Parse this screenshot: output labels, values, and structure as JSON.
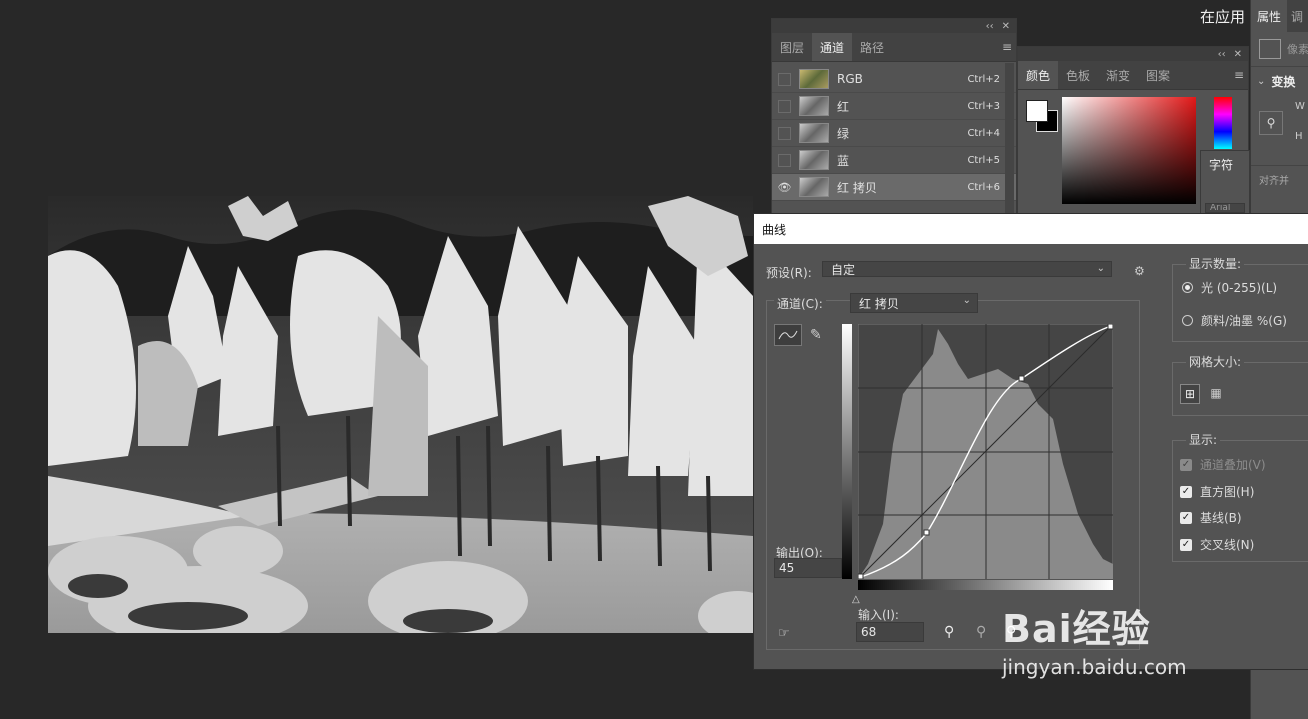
{
  "top_right_text": "在应用",
  "channels_panel": {
    "tabs": [
      "图层",
      "通道",
      "路径"
    ],
    "active_tab": "通道",
    "channels": [
      {
        "name": "RGB",
        "shortcut": "Ctrl+2",
        "visible": false
      },
      {
        "name": "红",
        "shortcut": "Ctrl+3",
        "visible": false
      },
      {
        "name": "绿",
        "shortcut": "Ctrl+4",
        "visible": false
      },
      {
        "name": "蓝",
        "shortcut": "Ctrl+5",
        "visible": false
      },
      {
        "name": "红 拷贝",
        "shortcut": "Ctrl+6",
        "visible": true
      }
    ]
  },
  "color_panel": {
    "tabs": [
      "颜色",
      "色板",
      "渐变",
      "图案"
    ],
    "active_tab": "颜色",
    "foreground": "#ffffff",
    "background": "#000000"
  },
  "character_panel": {
    "tab": "字符",
    "font_partial": "Arial"
  },
  "properties_panel": {
    "tabs": [
      "属性",
      "调"
    ],
    "partial_label": "像素",
    "section_transform": "变换",
    "w_label": "W",
    "h_label": "H",
    "section_align": "对齐并"
  },
  "curves": {
    "title": "曲线",
    "preset_label": "预设(R):",
    "preset_value": "自定",
    "channel_label": "通道(C):",
    "channel_value": "红 拷贝",
    "output_label": "输出(O):",
    "output_value": "45",
    "input_label": "输入(I):",
    "input_value": "68",
    "show_amount": {
      "title": "显示数量:",
      "options": [
        "光 (0-255)(L)",
        "颜料/油墨 %(G)"
      ],
      "selected": 0
    },
    "grid_size": {
      "title": "网格大小:"
    },
    "show": {
      "title": "显示:",
      "items": [
        {
          "label": "通道叠加(V)",
          "checked": true,
          "disabled": true
        },
        {
          "label": "直方图(H)",
          "checked": true,
          "disabled": false
        },
        {
          "label": "基线(B)",
          "checked": true,
          "disabled": false
        },
        {
          "label": "交叉线(N)",
          "checked": true,
          "disabled": false
        }
      ]
    },
    "curve_points": [
      [
        0,
        0
      ],
      [
        68,
        45
      ],
      [
        160,
        200
      ],
      [
        255,
        255
      ]
    ]
  },
  "watermark": {
    "brand": "Bai经验",
    "url": "jingyan.baidu.com"
  },
  "colors": {
    "bg": "#282828",
    "panel": "#535353",
    "dialog_title": "#ffffff"
  }
}
